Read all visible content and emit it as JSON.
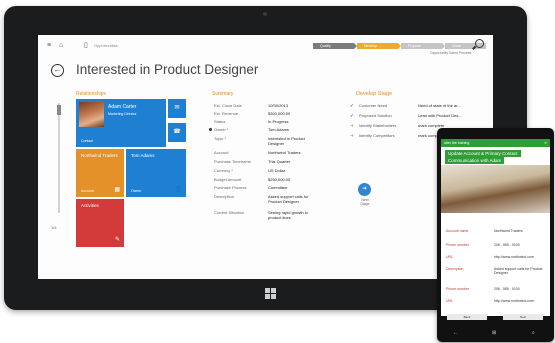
{
  "topbar": {
    "crumb": "Opportunities",
    "stages": [
      {
        "label": "Qualify",
        "state": "done"
      },
      {
        "label": "Develop",
        "state": "active"
      },
      {
        "label": "Propose",
        "state": "todo"
      },
      {
        "label": "Close",
        "state": "todo"
      }
    ],
    "process_label": "Opportunity Sales Process"
  },
  "title": "Interested in Product Designer",
  "relationships": {
    "heading": "Relationships",
    "slider_value": "1/4",
    "tiles": [
      {
        "name": "Adam Carter",
        "sub": "Marketing Director",
        "footer": "Contact",
        "color": "#1f7fd0"
      },
      {
        "name": "Northwind Traders",
        "sub": "Account",
        "color": "#e4912a"
      },
      {
        "name": "Tom Adams",
        "sub": "Owner",
        "color": "#1f7fd0"
      },
      {
        "name": "Activities",
        "sub": "",
        "color": "#d33a3a"
      }
    ]
  },
  "summary": {
    "heading": "Summary",
    "rows": [
      {
        "label": "Est. Close Date",
        "value": "10/30/2013"
      },
      {
        "label": "Est. Revenue",
        "value": "$300,000.00"
      },
      {
        "label": "Status",
        "value": "In Progress"
      },
      {
        "label": "Owner *",
        "value": "Tom Adams"
      },
      {
        "label": "Topic *",
        "value": "Interested in Product Designer"
      },
      {
        "label": "Account",
        "value": "Northwind Traders"
      },
      {
        "label": "Purchase Timeframe",
        "value": "This Quarter"
      },
      {
        "label": "Currency *",
        "value": "US Dollar"
      },
      {
        "label": "Budget Amount",
        "value": "$250,000.00"
      },
      {
        "label": "Purchase Process",
        "value": "Committee"
      },
      {
        "label": "Description",
        "value": "Asked support calls for Product Designer"
      },
      {
        "label": "Current Situation",
        "value": "Seeing rapid growth in product lines"
      }
    ]
  },
  "develop": {
    "heading": "Develop Stage",
    "rows": [
      {
        "mark": "✔",
        "mark_color": "#3aa041",
        "label": "Customer Need",
        "value": "Need of state of the ar..."
      },
      {
        "mark": "✔",
        "mark_color": "#3aa041",
        "label": "Proposed Solution",
        "value": "Lead with Product Des..."
      },
      {
        "mark": "➜",
        "mark_color": "#e38a1f",
        "label": "Identify Stakeholders",
        "value": "mark complete"
      },
      {
        "mark": "➜",
        "mark_color": "#e38a1f",
        "label": "Identify Competitors",
        "value": "mark complete"
      }
    ],
    "next_stage_label": "Next Stage"
  },
  "phone": {
    "bar_title": "after the training",
    "title_line1": "Update Account & Primary Contact",
    "title_line2": "Communication with Adam",
    "rows": [
      {
        "label": "Account name",
        "value": "Northwind Traders"
      },
      {
        "label": "Phone number",
        "value": "206 - 555 - 0100"
      },
      {
        "label": "URL",
        "value": "http://www.northwind.com"
      },
      {
        "label": "Description",
        "value": "Asked support calls for Product Designer"
      },
      {
        "label": "Phone number",
        "value": "206 - 555 - 0100"
      },
      {
        "label": "URL",
        "value": "http://www.northwind.com"
      }
    ],
    "btn_back": "Back",
    "btn_next": "Next"
  }
}
